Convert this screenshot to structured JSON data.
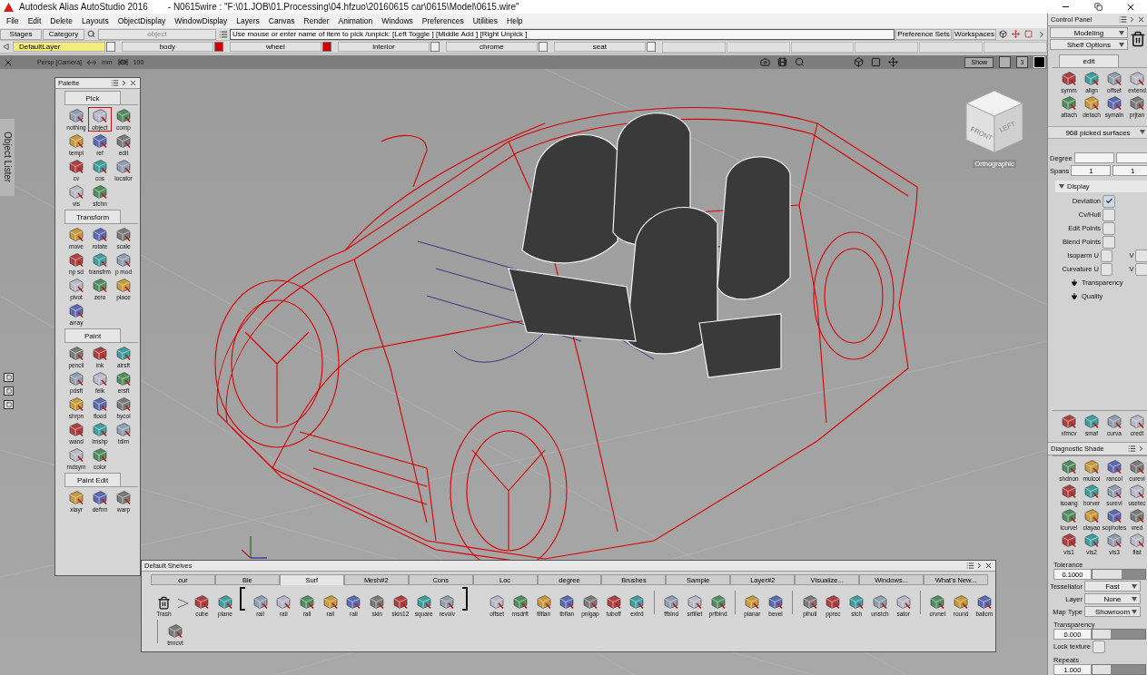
{
  "window": {
    "title": "Autodesk Alias AutoStudio 2016",
    "file": "- N0615wire : \"F:\\01.JOB\\01.Processing\\04.hfzuo\\20160615 car\\0615\\Model\\0615.wire\""
  },
  "menu": [
    "File",
    "Edit",
    "Delete",
    "Layouts",
    "ObjectDisplay",
    "WindowDisplay",
    "Layers",
    "Canvas",
    "Render",
    "Animation",
    "Windows",
    "Preferences",
    "Utilities",
    "Help"
  ],
  "toolbar": {
    "stages": "Stages",
    "category": "Category",
    "pick_field": "object",
    "prompt": "Use mouse or enter name of item to pick /unpick: [Left Toggle ] [Middle Add ] [Right Unpick ]",
    "buttons": [
      "Preference Sets",
      "Workspaces"
    ]
  },
  "layers": [
    {
      "label": "DefaultLayer",
      "selected": true,
      "color": "#eeeeee"
    },
    {
      "label": "body",
      "selected": false,
      "color": "#d40000"
    },
    {
      "label": "wheel",
      "selected": false,
      "color": "#d40000"
    },
    {
      "label": "interior",
      "selected": false,
      "color": "#eeeeee"
    },
    {
      "label": "chrome",
      "selected": false,
      "color": "#eeeeee"
    },
    {
      "label": "seat",
      "selected": false,
      "color": "#eeeeee"
    }
  ],
  "viewport": {
    "camera": "Persp [Camera]",
    "units": "mm",
    "scale": "100",
    "show_button": "Show",
    "view_count": "3",
    "cube_faces": [
      "FRONT",
      "LEFT"
    ],
    "projection": "Orthographic",
    "side_tab": "Object Lister"
  },
  "palette": {
    "title": "Palette",
    "sections": [
      {
        "title": "Pick",
        "tools": [
          {
            "label": "nothing",
            "selected": false
          },
          {
            "label": "object",
            "selected": true
          },
          {
            "label": "comp",
            "selected": false
          },
          {
            "label": "templ",
            "selected": false
          },
          {
            "label": "ref",
            "selected": false
          },
          {
            "label": "edit",
            "selected": false
          },
          {
            "label": "cv",
            "selected": false
          },
          {
            "label": "cos",
            "selected": false
          },
          {
            "label": "locator",
            "selected": false
          },
          {
            "label": "vis",
            "selected": false
          },
          {
            "label": "sfchn",
            "selected": false
          }
        ]
      },
      {
        "title": "Transform",
        "tools": [
          {
            "label": "move",
            "selected": false
          },
          {
            "label": "rotate",
            "selected": false
          },
          {
            "label": "scale",
            "selected": false
          },
          {
            "label": "np sd",
            "selected": false
          },
          {
            "label": "transfrm",
            "selected": false
          },
          {
            "label": "p mod",
            "selected": false
          },
          {
            "label": "pivot",
            "selected": false
          },
          {
            "label": "zero",
            "selected": false
          },
          {
            "label": "place",
            "selected": false
          },
          {
            "label": "array",
            "selected": false
          }
        ]
      },
      {
        "title": "Paint",
        "tools": [
          {
            "label": "pencil",
            "selected": false
          },
          {
            "label": "ink",
            "selected": false
          },
          {
            "label": "airsft",
            "selected": false
          },
          {
            "label": "pdsft",
            "selected": false
          },
          {
            "label": "felk",
            "selected": false
          },
          {
            "label": "ersft",
            "selected": false
          },
          {
            "label": "shrpn",
            "selected": false
          },
          {
            "label": "flood",
            "selected": false
          },
          {
            "label": "bycol",
            "selected": false
          },
          {
            "label": "wand",
            "selected": false
          },
          {
            "label": "imshp",
            "selected": false
          },
          {
            "label": "tdim",
            "selected": false
          },
          {
            "label": "mdsym",
            "selected": false
          },
          {
            "label": "color",
            "selected": false
          }
        ]
      },
      {
        "title": "Paint Edit",
        "tools": [
          {
            "label": "xlayr",
            "selected": false
          },
          {
            "label": "defrm",
            "selected": false
          },
          {
            "label": "warp",
            "selected": false
          }
        ]
      }
    ]
  },
  "shelf": {
    "title": "Default Shelves",
    "tabs": [
      {
        "label": "cur",
        "selected": false
      },
      {
        "label": "Ble",
        "selected": false
      },
      {
        "label": "Surf",
        "selected": true
      },
      {
        "label": "Mesh#2",
        "selected": false
      },
      {
        "label": "Cons",
        "selected": false
      },
      {
        "label": "Loc",
        "selected": false
      },
      {
        "label": "degree",
        "selected": false
      },
      {
        "label": "Brushes",
        "selected": false
      },
      {
        "label": "Sample",
        "selected": false
      },
      {
        "label": "Layer#2",
        "selected": false
      },
      {
        "label": "Visualize...",
        "selected": false
      },
      {
        "label": "Windows...",
        "selected": false
      },
      {
        "label": "What's New...",
        "selected": false
      }
    ],
    "rows": [
      [
        {
          "kind": "trash",
          "label": "Trash"
        },
        {
          "kind": "arrow"
        },
        {
          "kind": "tool",
          "label": "cube"
        },
        {
          "kind": "tool",
          "label": "plane"
        },
        {
          "kind": "bracket_open"
        },
        {
          "kind": "tool",
          "label": "rail"
        },
        {
          "kind": "tool",
          "label": "rail"
        },
        {
          "kind": "tool",
          "label": "rail"
        },
        {
          "kind": "tool",
          "label": "rail"
        },
        {
          "kind": "tool",
          "label": "rail"
        },
        {
          "kind": "tool",
          "label": "skin"
        },
        {
          "kind": "tool",
          "label": "skin12"
        },
        {
          "kind": "tool",
          "label": "square"
        },
        {
          "kind": "tool",
          "label": "revolv"
        },
        {
          "kind": "bracket_close"
        },
        {
          "kind": "gap"
        },
        {
          "kind": "tool",
          "label": "offset"
        },
        {
          "kind": "tool",
          "label": "msdrft"
        },
        {
          "kind": "tool",
          "label": "filflan"
        },
        {
          "kind": "tool",
          "label": "tbflan"
        },
        {
          "kind": "tool",
          "label": "pnlgap"
        },
        {
          "kind": "tool",
          "label": "tuboff"
        },
        {
          "kind": "tool",
          "label": "extrd"
        },
        {
          "kind": "divider"
        },
        {
          "kind": "tool",
          "label": "ffblnd"
        },
        {
          "kind": "tool",
          "label": "srfillet"
        },
        {
          "kind": "tool",
          "label": "prfblnd"
        },
        {
          "kind": "divider"
        },
        {
          "kind": "tool",
          "label": "planar"
        },
        {
          "kind": "tool",
          "label": "bevel"
        },
        {
          "kind": "divider"
        },
        {
          "kind": "tool",
          "label": "plhull"
        },
        {
          "kind": "tool",
          "label": "pprec"
        },
        {
          "kind": "tool",
          "label": "stch"
        },
        {
          "kind": "tool",
          "label": "unstch"
        },
        {
          "kind": "tool",
          "label": "sator"
        },
        {
          "kind": "divider"
        },
        {
          "kind": "tool",
          "label": "crvnet"
        },
        {
          "kind": "tool",
          "label": "round"
        },
        {
          "kind": "tool",
          "label": "ballcm"
        }
      ],
      [
        {
          "kind": "divider"
        },
        {
          "kind": "tool",
          "label": "trmcvt"
        }
      ]
    ]
  },
  "control_panel": {
    "title": "Control Panel",
    "mode": "Modeling",
    "shelf_options": "Shelf Options",
    "tab": "edit",
    "edit_tools": [
      "symm",
      "align",
      "offset",
      "extend",
      "attach",
      "detach",
      "symaln",
      "prjtan"
    ],
    "picked": "968 picked surfaces",
    "degree": {
      "label": "Degree"
    },
    "spans": {
      "label": "Spans",
      "values": [
        "1",
        "1"
      ]
    },
    "display": {
      "title": "Display",
      "options": [
        {
          "label": "Deviation",
          "checked": true
        },
        {
          "label": "Cv/Hull",
          "checked": false
        },
        {
          "label": "Edit Points",
          "checked": false
        },
        {
          "label": "Blend Points",
          "checked": false
        },
        {
          "label": "Isoparm U",
          "checked": false,
          "v_label": "V",
          "v_checked": false
        },
        {
          "label": "Curvature U",
          "checked": false,
          "v_label": "V",
          "v_checked": false
        }
      ],
      "subsections": [
        "Transparency",
        "Quality"
      ]
    },
    "misc_tools": [
      "xfmcv",
      "smaf",
      "curva",
      "credt"
    ],
    "diagnostic": {
      "title": "Diagnostic Shade",
      "tools": [
        "shdnon",
        "mulcol",
        "rancol",
        "curevl",
        "isoang",
        "horver",
        "surevl",
        "usetec",
        "lcurvel",
        "clayao",
        "sophotes",
        "vred",
        "vis1",
        "vis2",
        "vis3",
        "flist"
      ]
    },
    "tolerance": {
      "label": "Tolerance",
      "value": "0.1000",
      "level": 0.55
    },
    "tessellator": {
      "label": "Tessellator",
      "value": "Fast"
    },
    "layer": {
      "label": "Layer",
      "value": "None"
    },
    "map_type": {
      "label": "Map Type",
      "value": "Showroom"
    },
    "transparency": {
      "label": "Transparency",
      "value": "0.000",
      "level": 0.35
    },
    "lock_texture": {
      "label": "Lock texture",
      "checked": false
    },
    "repeats": {
      "label": "Repeats",
      "value": "1.000",
      "level": 0.35
    }
  }
}
